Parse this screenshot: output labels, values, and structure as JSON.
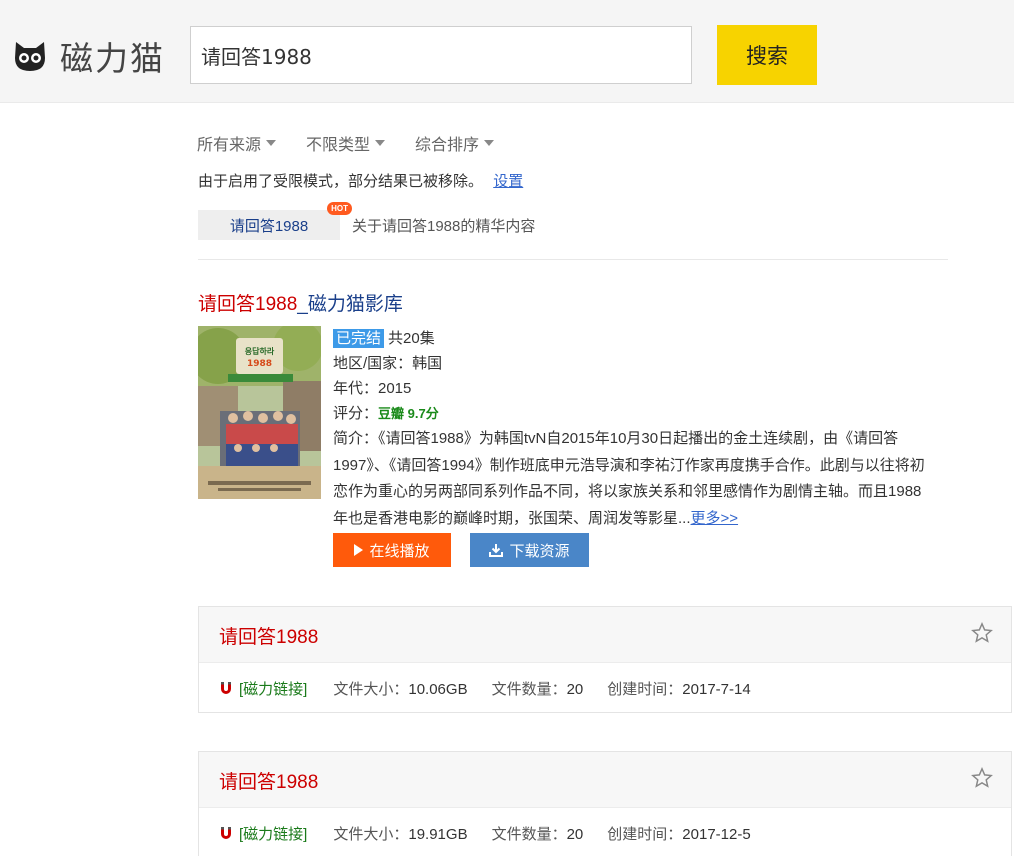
{
  "header": {
    "logo_text": "磁力猫",
    "search_value": "请回答1988",
    "search_button": "搜索"
  },
  "filters": [
    "所有来源",
    "不限类型",
    "综合排序"
  ],
  "notice": {
    "text_prefix": "由于启用了",
    "text_mode": "受限模式",
    "text_suffix": "，部分结果已被移除。",
    "link": "设置"
  },
  "hot": {
    "tab_label": "请回答1988",
    "badge": "HOT",
    "description": "关于请回答1988的精华内容"
  },
  "film": {
    "title_main": "请回答1988",
    "title_suffix": "_磁力猫影库",
    "status": "已完结",
    "episodes": "共20集",
    "region": "地区/国家：韩国",
    "year": "年代：2015",
    "score_label": "评分：",
    "score_value": "豆瓣 9.7分",
    "summary": "简介：《请回答1988》为韩国tvN自2015年10月30日起播出的金土连续剧，由《请回答1997》、《请回答1994》制作班底申元浩导演和李祐汀作家再度携手合作。此剧与以往将初恋作为重心的另两部同系列作品不同，将以家族关系和邻里感情作为剧情主轴。而且1988年也是香港电影的巅峰时期，张国荣、周润发等影星...",
    "more": "更多>>",
    "play_button": "在线播放",
    "download_button": "下载资源",
    "poster_text": "응답하라 1988"
  },
  "results": [
    {
      "title": "请回答1988",
      "link_label": "[磁力链接]",
      "size_label": "文件大小：",
      "size": "10.06GB",
      "count_label": "文件数量：",
      "count": "20",
      "time_label": "创建时间：",
      "time": "2017-7-14"
    },
    {
      "title": "请回答1988",
      "link_label": "[磁力链接]",
      "size_label": "文件大小：",
      "size": "19.91GB",
      "count_label": "文件数量：",
      "count": "20",
      "time_label": "创建时间：",
      "time": "2017-12-5"
    }
  ],
  "colors": {
    "search_button": "#f7d300",
    "play_button": "#ff5a0b",
    "download_button": "#4a86c8",
    "title_red": "#cc0000",
    "magnet_green": "#1a7a1a"
  }
}
